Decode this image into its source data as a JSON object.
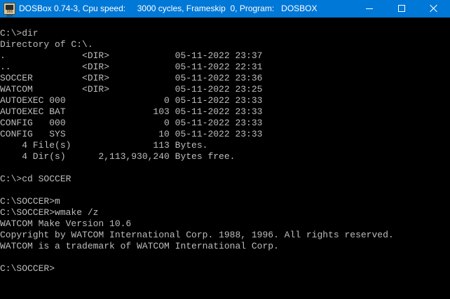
{
  "window": {
    "title": "DOSBox 0.74-3, Cpu speed:     3000 cycles, Frameskip  0, Program:   DOSBOX",
    "icon_label": "DOS BOX",
    "icon": "dosbox-icon",
    "buttons": {
      "minimize": "minimize-icon",
      "maximize": "maximize-icon",
      "close": "close-icon"
    },
    "titlebar_color": "#0078d7",
    "text_color": "#bdbdbd"
  },
  "console": {
    "lines": [
      "C:\\>dir",
      "Directory of C:\\.",
      ".              <DIR>            05-11-2022 23:37",
      "..             <DIR>            05-11-2022 22:31",
      "SOCCER         <DIR>            05-11-2022 23:36",
      "WATCOM         <DIR>            05-11-2022 23:25",
      "AUTOEXEC 000                  0 05-11-2022 23:33",
      "AUTOEXEC BAT                103 05-11-2022 23:33",
      "CONFIG   000                  0 05-11-2022 23:33",
      "CONFIG   SYS                 10 05-11-2022 23:33",
      "    4 File(s)               113 Bytes.",
      "    4 Dir(s)      2,113,930,240 Bytes free.",
      "",
      "C:\\>cd SOCCER",
      "",
      "C:\\SOCCER>m",
      "C:\\SOCCER>wmake /z",
      "WATCOM Make Version 10.6",
      "Copyright by WATCOM International Corp. 1988, 1996. All rights reserved.",
      "WATCOM is a trademark of WATCOM International Corp.",
      "",
      "C:\\SOCCER>"
    ]
  }
}
